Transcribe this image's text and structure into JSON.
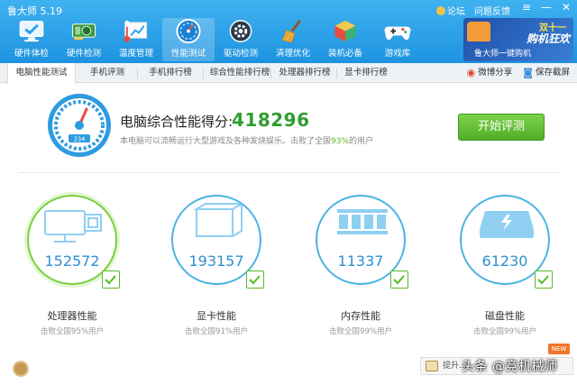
{
  "app": {
    "title": "鲁大师 5.19",
    "links": [
      "论坛",
      "问题反馈"
    ],
    "window_controls": [
      "menu-icon",
      "minimize-icon",
      "close-icon"
    ]
  },
  "tools": [
    {
      "label": "硬件体检",
      "icon": "monitor-check-icon"
    },
    {
      "label": "硬件检测",
      "icon": "graphics-card-icon"
    },
    {
      "label": "温度管理",
      "icon": "thermometer-chart-icon"
    },
    {
      "label": "性能测试",
      "icon": "speedometer-icon",
      "active": true
    },
    {
      "label": "驱动检测",
      "icon": "driver-gear-icon"
    },
    {
      "label": "清理优化",
      "icon": "broom-icon"
    },
    {
      "label": "装机必备",
      "icon": "cube-box-icon"
    },
    {
      "label": "游戏库",
      "icon": "gamepad-icon"
    }
  ],
  "ad": {
    "line1": "双十一",
    "line2": "购机狂欢",
    "line3": "鲁大师一键购机"
  },
  "tabs": [
    {
      "label": "电脑性能测试",
      "active": true
    },
    {
      "label": "手机评测"
    },
    {
      "label": "手机排行榜"
    },
    {
      "label": "综合性能排行榜"
    },
    {
      "label": "处理器排行榜"
    },
    {
      "label": "显卡排行榜"
    }
  ],
  "tab_actions": {
    "share": "微博分享",
    "screenshot": "保存截屏"
  },
  "score": {
    "gauge_readout": "234",
    "label": "电脑综合性能得分:",
    "value": "418296",
    "desc_prefix": "本电脑可以流畅运行大型游戏及各种发烧娱乐。击败了全国",
    "desc_pct": "93%",
    "desc_suffix": "的用户"
  },
  "eval_button": "开始评测",
  "components": [
    {
      "name": "处理器性能",
      "score": "152572",
      "beat": "击败全国95%用户",
      "icon": "cpu-icon",
      "highlighted": true
    },
    {
      "name": "显卡性能",
      "score": "193157",
      "beat": "击败全国91%用户",
      "icon": "graphics-card-icon"
    },
    {
      "name": "内存性能",
      "score": "11337",
      "beat": "击败全国99%用户",
      "icon": "memory-chip-icon"
    },
    {
      "name": "磁盘性能",
      "score": "61230",
      "beat": "击败全国99%用户",
      "icon": "hard-disk-icon"
    }
  ],
  "footer": {
    "upgrade": "提升…",
    "new_badge": "NEW",
    "watermark": "头条 @竞机械师"
  },
  "colors": {
    "header": "#1e93e0",
    "accent_green": "#2f9e2f",
    "ring_blue": "#4db3e6",
    "ring_green": "#7ccf3d",
    "score_blue": "#2d8fd3"
  }
}
